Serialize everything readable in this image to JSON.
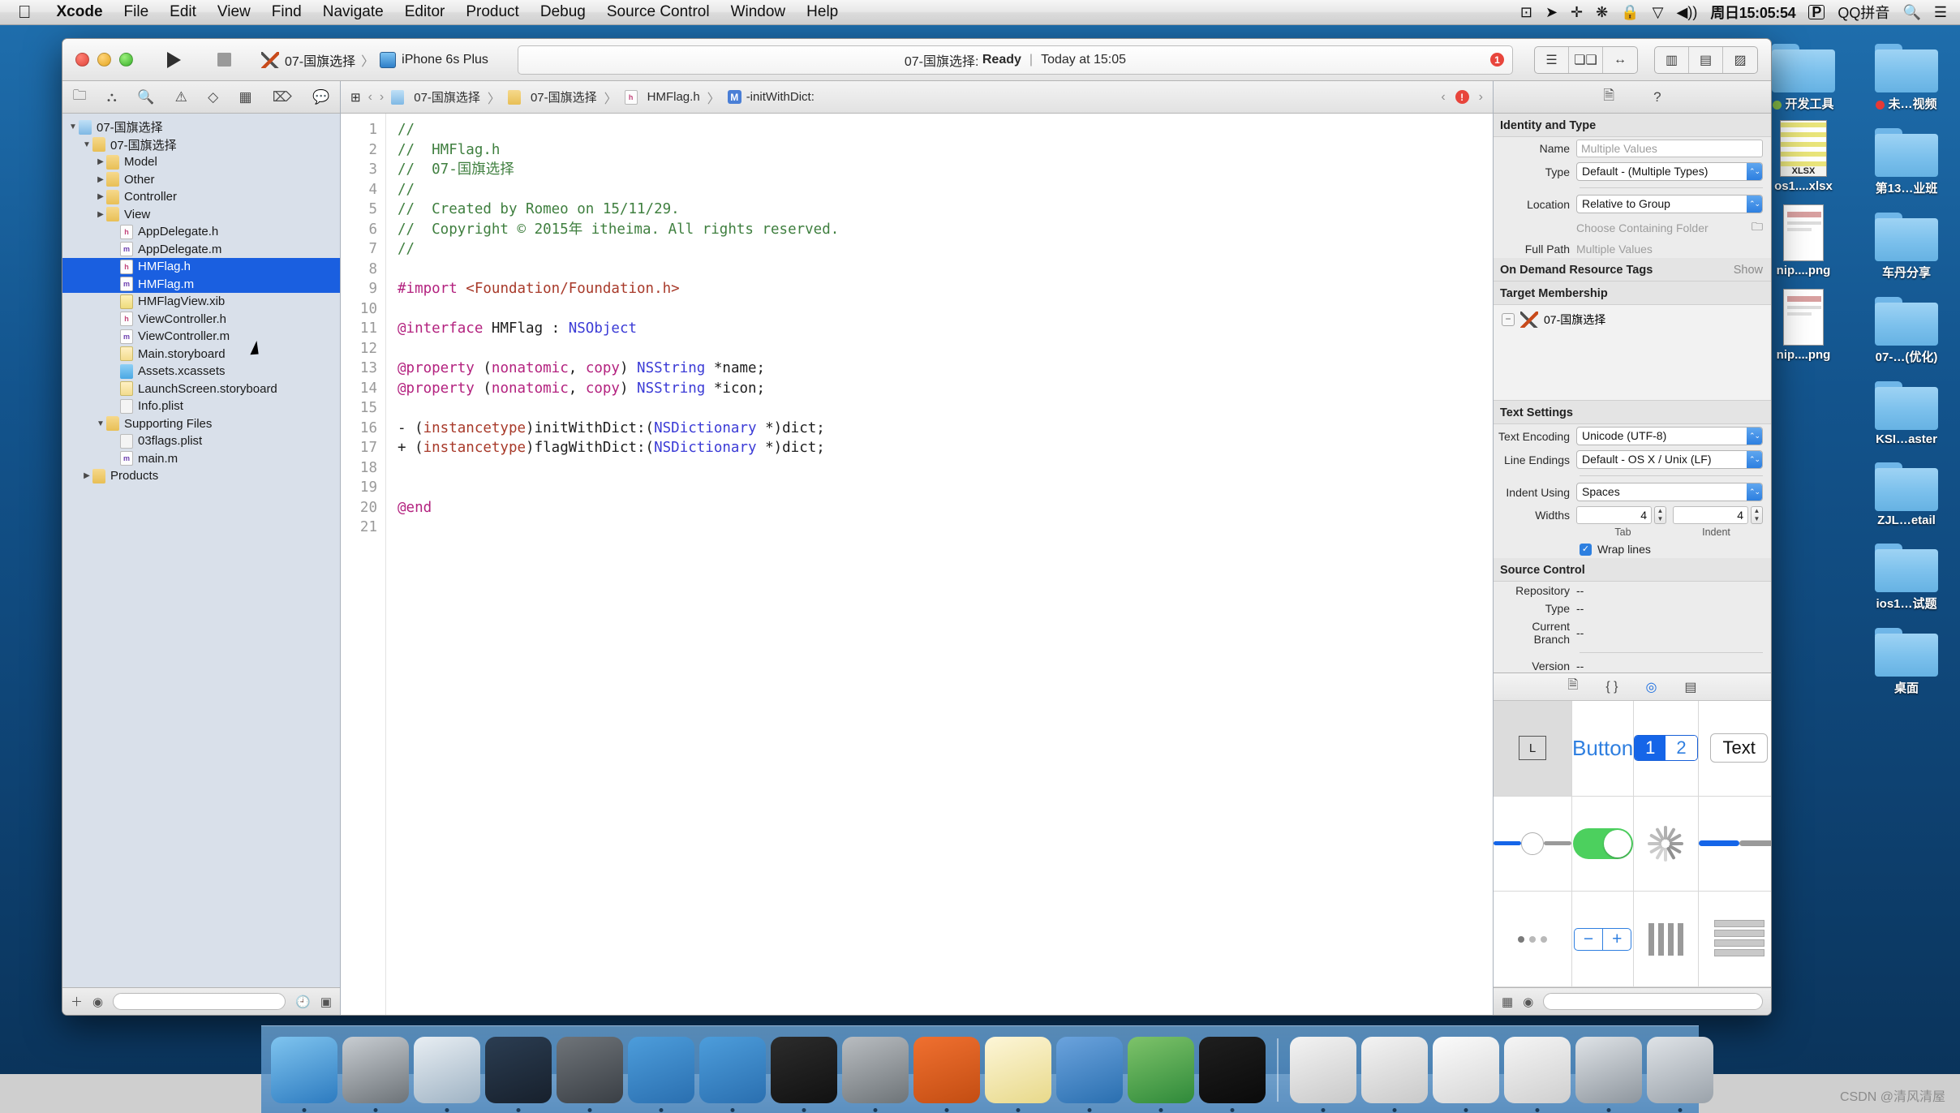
{
  "menubar": {
    "apple_icon": "apple-icon",
    "items": [
      "Xcode",
      "File",
      "Edit",
      "View",
      "Find",
      "Navigate",
      "Editor",
      "Product",
      "Debug",
      "Source Control",
      "Window",
      "Help"
    ],
    "status_icons": [
      "screen-record-icon",
      "location-arrow-icon",
      "bluetooth-icon",
      "dnd-icon",
      "lock-icon",
      "wifi-icon",
      "volume-icon"
    ],
    "clock": "周日15:05:54",
    "input_badge": "P",
    "input_method": "QQ拼音",
    "search_icon": "search-icon",
    "notification_icon": "notification-center-icon"
  },
  "toolbar": {
    "run_icon": "run-play-icon",
    "stop_icon": "stop-square-icon",
    "scheme_name": "07-国旗选择",
    "scheme_separator": "〉",
    "destination": "iPhone 6s Plus",
    "activity_project": "07-国旗选择:",
    "activity_status": "Ready",
    "activity_sep": "|",
    "activity_time": "Today at 15:05",
    "issue_count": "1",
    "editor_segments": [
      "standard-editor-icon",
      "assistant-editor-icon",
      "version-editor-icon"
    ],
    "view_segments": [
      "hide-navigator-icon",
      "hide-debug-icon",
      "hide-utilities-icon"
    ]
  },
  "navigator": {
    "tabs": [
      "folder-project-icon",
      "source-control-icon",
      "search-icon",
      "issue-warning-icon",
      "test-diamond-icon",
      "debug-icon",
      "breakpoint-icon",
      "report-log-icon"
    ],
    "tree": [
      {
        "label": "07-国旗选择",
        "indent": 0,
        "arrow": "▼",
        "icon": "proj",
        "selected": false
      },
      {
        "label": "07-国旗选择",
        "indent": 1,
        "arrow": "▼",
        "icon": "folder",
        "selected": false
      },
      {
        "label": "Model",
        "indent": 2,
        "arrow": "▶",
        "icon": "folder",
        "selected": false
      },
      {
        "label": "Other",
        "indent": 2,
        "arrow": "▶",
        "icon": "folder",
        "selected": false
      },
      {
        "label": "Controller",
        "indent": 2,
        "arrow": "▶",
        "icon": "folder",
        "selected": false
      },
      {
        "label": "View",
        "indent": 2,
        "arrow": "▶",
        "icon": "folder",
        "selected": false
      },
      {
        "label": "AppDelegate.h",
        "indent": 3,
        "arrow": "",
        "icon": "h",
        "selected": false
      },
      {
        "label": "AppDelegate.m",
        "indent": 3,
        "arrow": "",
        "icon": "m",
        "selected": false
      },
      {
        "label": "HMFlag.h",
        "indent": 3,
        "arrow": "",
        "icon": "h",
        "selected": true
      },
      {
        "label": "HMFlag.m",
        "indent": 3,
        "arrow": "",
        "icon": "m",
        "selected": true
      },
      {
        "label": "HMFlagView.xib",
        "indent": 3,
        "arrow": "",
        "icon": "xib",
        "selected": false
      },
      {
        "label": "ViewController.h",
        "indent": 3,
        "arrow": "",
        "icon": "h",
        "selected": false
      },
      {
        "label": "ViewController.m",
        "indent": 3,
        "arrow": "",
        "icon": "m",
        "selected": false
      },
      {
        "label": "Main.storyboard",
        "indent": 3,
        "arrow": "",
        "icon": "sb",
        "selected": false
      },
      {
        "label": "Assets.xcassets",
        "indent": 3,
        "arrow": "",
        "icon": "xc",
        "selected": false
      },
      {
        "label": "LaunchScreen.storyboard",
        "indent": 3,
        "arrow": "",
        "icon": "sb",
        "selected": false
      },
      {
        "label": "Info.plist",
        "indent": 3,
        "arrow": "",
        "icon": "plist",
        "selected": false
      },
      {
        "label": "Supporting Files",
        "indent": 2,
        "arrow": "▼",
        "icon": "folder",
        "selected": false
      },
      {
        "label": "03flags.plist",
        "indent": 3,
        "arrow": "",
        "icon": "plist",
        "selected": false
      },
      {
        "label": "main.m",
        "indent": 3,
        "arrow": "",
        "icon": "m",
        "selected": false
      },
      {
        "label": "Products",
        "indent": 1,
        "arrow": "▶",
        "icon": "folder",
        "selected": false
      }
    ],
    "footer": {
      "add_icon": "plus-icon",
      "filter_icon": "filter-circle-icon",
      "recent_icon": "clock-icon",
      "unsaved_icon": "source-control-icon",
      "filter_placeholder": ""
    }
  },
  "jumpbar": {
    "related_icon": "related-items-icon",
    "back_icon": "chevron-left-icon",
    "forward_icon": "chevron-right-icon",
    "crumbs": [
      "07-国旗选择",
      "07-国旗选择",
      "HMFlag.h",
      "-initWithDict:"
    ],
    "separator": "〉",
    "issue_prev_icon": "chevron-left-icon",
    "issue_badge_icon": "error-circle-icon",
    "issue_next_icon": "chevron-right-icon"
  },
  "editor": {
    "lines": [
      {
        "n": "1",
        "tokens": [
          {
            "t": "//",
            "c": "c-cmt"
          }
        ]
      },
      {
        "n": "2",
        "tokens": [
          {
            "t": "//  HMFlag.h",
            "c": "c-cmt"
          }
        ]
      },
      {
        "n": "3",
        "tokens": [
          {
            "t": "//  07-国旗选择",
            "c": "c-cmt"
          }
        ]
      },
      {
        "n": "4",
        "tokens": [
          {
            "t": "//",
            "c": "c-cmt"
          }
        ]
      },
      {
        "n": "5",
        "tokens": [
          {
            "t": "//  Created by Romeo on 15/11/29.",
            "c": "c-cmt"
          }
        ]
      },
      {
        "n": "6",
        "tokens": [
          {
            "t": "//  Copyright © 2015年 itheima. All rights reserved.",
            "c": "c-cmt"
          }
        ]
      },
      {
        "n": "7",
        "tokens": [
          {
            "t": "//",
            "c": "c-cmt"
          }
        ]
      },
      {
        "n": "8",
        "tokens": []
      },
      {
        "n": "9",
        "tokens": [
          {
            "t": "#import ",
            "c": "c-kw"
          },
          {
            "t": "<Foundation/Foundation.h>",
            "c": "c-pre"
          }
        ]
      },
      {
        "n": "10",
        "tokens": []
      },
      {
        "n": "11",
        "tokens": [
          {
            "t": "@interface ",
            "c": "c-kw"
          },
          {
            "t": "HMFlag",
            "c": "c-cls"
          },
          {
            "t": " : ",
            "c": "c-cls"
          },
          {
            "t": "NSObject",
            "c": "c-typ"
          }
        ]
      },
      {
        "n": "12",
        "tokens": []
      },
      {
        "n": "13",
        "tokens": [
          {
            "t": "@property ",
            "c": "c-kw"
          },
          {
            "t": "(",
            "c": "c-cls"
          },
          {
            "t": "nonatomic",
            "c": "c-kw"
          },
          {
            "t": ", ",
            "c": "c-cls"
          },
          {
            "t": "copy",
            "c": "c-kw"
          },
          {
            "t": ") ",
            "c": "c-cls"
          },
          {
            "t": "NSString",
            "c": "c-typ"
          },
          {
            "t": " *name;",
            "c": "c-cls"
          }
        ]
      },
      {
        "n": "14",
        "tokens": [
          {
            "t": "@property ",
            "c": "c-kw"
          },
          {
            "t": "(",
            "c": "c-cls"
          },
          {
            "t": "nonatomic",
            "c": "c-kw"
          },
          {
            "t": ", ",
            "c": "c-cls"
          },
          {
            "t": "copy",
            "c": "c-kw"
          },
          {
            "t": ") ",
            "c": "c-cls"
          },
          {
            "t": "NSString",
            "c": "c-typ"
          },
          {
            "t": " *icon;",
            "c": "c-cls"
          }
        ]
      },
      {
        "n": "15",
        "tokens": []
      },
      {
        "n": "16",
        "tokens": [
          {
            "t": "- (",
            "c": "c-cls"
          },
          {
            "t": "instancetype",
            "c": "c-pre"
          },
          {
            "t": ")initWithDict:(",
            "c": "c-cls"
          },
          {
            "t": "NSDictionary",
            "c": "c-typ"
          },
          {
            "t": " *)dict;",
            "c": "c-cls"
          }
        ]
      },
      {
        "n": "17",
        "tokens": [
          {
            "t": "+ (",
            "c": "c-cls"
          },
          {
            "t": "instancetype",
            "c": "c-pre"
          },
          {
            "t": ")flagWithDict:(",
            "c": "c-cls"
          },
          {
            "t": "NSDictionary",
            "c": "c-typ"
          },
          {
            "t": " *)dict;",
            "c": "c-cls"
          }
        ]
      },
      {
        "n": "18",
        "tokens": []
      },
      {
        "n": "19",
        "tokens": []
      },
      {
        "n": "20",
        "tokens": [
          {
            "t": "@end",
            "c": "c-kw"
          }
        ]
      },
      {
        "n": "21",
        "tokens": []
      }
    ]
  },
  "inspector": {
    "tabs": [
      "file-inspector-icon",
      "quick-help-icon"
    ],
    "identity": {
      "title": "Identity and Type",
      "name_label": "Name",
      "name_value": "Multiple Values",
      "type_label": "Type",
      "type_value": "Default - (Multiple Types)",
      "location_label": "Location",
      "location_value": "Relative to Group",
      "choose_folder": "Choose Containing Folder",
      "folder_icon": "folder-icon",
      "fullpath_label": "Full Path",
      "fullpath_value": "Multiple Values"
    },
    "ondemand": {
      "title": "On Demand Resource Tags",
      "show": "Show"
    },
    "target_membership": {
      "title": "Target Membership",
      "target": "07-国旗选择",
      "minus": "−",
      "target_icon": "axe-target-icon"
    },
    "text_settings": {
      "title": "Text Settings",
      "encoding_label": "Text Encoding",
      "encoding_value": "Unicode (UTF-8)",
      "endings_label": "Line Endings",
      "endings_value": "Default - OS X / Unix (LF)",
      "indent_label": "Indent Using",
      "indent_value": "Spaces",
      "widths_label": "Widths",
      "tab_width": "4",
      "indent_width": "4",
      "tab_caption": "Tab",
      "indent_caption": "Indent",
      "wrap_label": "Wrap lines",
      "wrap_checked": true,
      "check_mark": "✓"
    },
    "source_control": {
      "title": "Source Control",
      "repository_label": "Repository",
      "repository_value": "--",
      "type_label": "Type",
      "type_value": "--",
      "branch_label": "Current Branch",
      "branch_value": "--",
      "version_label": "Version",
      "version_value": "--"
    },
    "library": {
      "tabs": [
        "file-template-library-icon",
        "code-snippet-library-icon",
        "object-library-icon",
        "media-library-icon"
      ],
      "active_tab_index": 2,
      "items": [
        {
          "name": "label-object",
          "label": "L",
          "kind": "label"
        },
        {
          "name": "button-object",
          "label": "Button",
          "kind": "button"
        },
        {
          "name": "segmented-control-object",
          "label": "1 2",
          "kind": "segmented"
        },
        {
          "name": "text-field-object",
          "label": "Text",
          "kind": "textfield"
        },
        {
          "name": "slider-object",
          "label": "",
          "kind": "slider"
        },
        {
          "name": "switch-object",
          "label": "",
          "kind": "switch"
        },
        {
          "name": "activity-indicator-object",
          "label": "",
          "kind": "spinner"
        },
        {
          "name": "progress-view-object",
          "label": "",
          "kind": "progress"
        },
        {
          "name": "page-control-object",
          "label": "",
          "kind": "pagecontrol"
        },
        {
          "name": "stepper-object",
          "label": "− +",
          "kind": "stepper"
        },
        {
          "name": "picker-view-object",
          "label": "",
          "kind": "bars"
        },
        {
          "name": "table-view-object",
          "label": "",
          "kind": "table"
        }
      ]
    },
    "footer": {
      "grid_icon": "grid-view-icon",
      "filter_icon": "filter-circle-icon",
      "filter_placeholder": ""
    }
  },
  "desktop": {
    "icons": [
      {
        "name": "开发工具",
        "kind": "folder",
        "tag": "#8bc34a"
      },
      {
        "name": "未…视频",
        "kind": "folder",
        "tag": "#e53935"
      },
      {
        "name": "os1....xlsx",
        "kind": "xlsx",
        "badge": "XLSX"
      },
      {
        "name": "第13…业班",
        "kind": "folder",
        "tag": ""
      },
      {
        "name": "nip....png",
        "kind": "png",
        "badge": ""
      },
      {
        "name": "车丹分享",
        "kind": "folder",
        "tag": ""
      },
      {
        "name": "nip....png",
        "kind": "png",
        "badge": ""
      },
      {
        "name": "07-…(优化)",
        "kind": "folder",
        "tag": ""
      },
      {
        "name": "",
        "kind": "blank",
        "tag": ""
      },
      {
        "name": "KSI…aster",
        "kind": "folder",
        "tag": ""
      },
      {
        "name": "",
        "kind": "blank",
        "tag": ""
      },
      {
        "name": "ZJL…etail",
        "kind": "folder",
        "tag": ""
      },
      {
        "name": "",
        "kind": "blank",
        "tag": ""
      },
      {
        "name": "ios1…试题",
        "kind": "folder",
        "tag": ""
      },
      {
        "name": "",
        "kind": "blank",
        "tag": ""
      },
      {
        "name": "桌面",
        "kind": "folder",
        "tag": ""
      }
    ]
  },
  "dock": {
    "apps": [
      {
        "name": "finder",
        "color1": "#7fc4ef",
        "color2": "#2d7bc0"
      },
      {
        "name": "launchpad",
        "color1": "#c8cdd2",
        "color2": "#6d7378"
      },
      {
        "name": "safari",
        "color1": "#e8eef3",
        "color2": "#9fb3c4"
      },
      {
        "name": "app-dark",
        "color1": "#2b3d52",
        "color2": "#17202c"
      },
      {
        "name": "quicktime",
        "color1": "#6f7479",
        "color2": "#3a3f45"
      },
      {
        "name": "xcode",
        "color1": "#4d9ddb",
        "color2": "#2a6fb0"
      },
      {
        "name": "xcode-beta",
        "color1": "#4d9ddb",
        "color2": "#2a6fb0"
      },
      {
        "name": "terminal",
        "color1": "#2c2c2c",
        "color2": "#111111"
      },
      {
        "name": "system-preferences",
        "color1": "#b9bdc1",
        "color2": "#6e7478"
      },
      {
        "name": "hand-brake",
        "color1": "#f07030",
        "color2": "#c34d12"
      },
      {
        "name": "notes",
        "color1": "#fdf6d8",
        "color2": "#e8d98a"
      },
      {
        "name": "word",
        "color1": "#6ba3dd",
        "color2": "#2a6fb0"
      },
      {
        "name": "excel",
        "color1": "#7ec36a",
        "color2": "#2f8a3a"
      },
      {
        "name": "iterm",
        "color1": "#1f1f1f",
        "color2": "#0a0a0a"
      },
      {
        "name": "separator",
        "color1": "",
        "color2": ""
      },
      {
        "name": "doc-window-1",
        "color1": "#f3f3f3",
        "color2": "#c9c9c9"
      },
      {
        "name": "doc-window-2",
        "color1": "#f3f3f3",
        "color2": "#c9c9c9"
      },
      {
        "name": "doc-note",
        "color1": "#fbfbfb",
        "color2": "#d6d6d6"
      },
      {
        "name": "doc-sketch",
        "color1": "#f5f5f5",
        "color2": "#cfcfcf"
      },
      {
        "name": "screen-shot",
        "color1": "#dfe3e7",
        "color2": "#8e969e"
      },
      {
        "name": "trash",
        "color1": "#dfe3e7",
        "color2": "#9aa2aa"
      }
    ]
  },
  "watermark": "CSDN @清风清屋"
}
